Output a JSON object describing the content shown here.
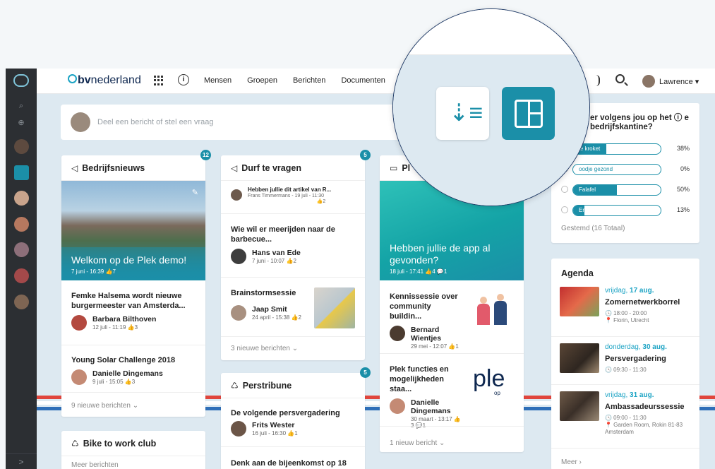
{
  "rail": {
    "collapse_glyph": ">"
  },
  "topbar": {
    "brand_bold": "bv",
    "brand_rest": "nederland",
    "nav": [
      "Mensen",
      "Groepen",
      "Berichten",
      "Documenten",
      "Ag"
    ],
    "user_name": "Lawrence ▾"
  },
  "post_box": {
    "placeholder": "Deel een bericht of stel een vraag"
  },
  "colors": {
    "accent": "#1b8fa8",
    "brand_navy": "#0f2850",
    "rail": "#2c2f33"
  },
  "col1": {
    "news": {
      "title": "Bedrijfsnieuws",
      "badge": "12",
      "hero_title": "Welkom op de Plek demo!",
      "hero_meta": "7 juni - 16:39  👍7",
      "items": [
        {
          "title": "Femke Halsema wordt nieuwe burgermeester van Amsterda...",
          "author": "Barbara Bilthoven",
          "meta": "12 juli - 11:19  👍3"
        },
        {
          "title": "Young Solar Challenge 2018",
          "author": "Danielle Dingemans",
          "meta": "9 juli - 15:05  👍3"
        }
      ],
      "more": "9 nieuwe berichten ⌄"
    },
    "bike": {
      "title": "Bike to work club",
      "more": "Meer berichten"
    }
  },
  "col2": {
    "ask": {
      "title": "Durf te vragen",
      "badge": "5",
      "items": [
        {
          "title": "Hebben jullie dit artikel van R...",
          "meta": "Frans Timmermans - 19 juli - 11:30",
          "likes": "👍2"
        },
        {
          "title": "Wie wil er meerijden naar de barbecue...",
          "author": "Hans van Ede",
          "meta": "7 juni - 10:07  👍2"
        },
        {
          "title": "Brainstormsessie",
          "author": "Jaap Smit",
          "meta": "24 april - 15:38  👍2"
        }
      ],
      "more": "3 nieuwe berichten ⌄"
    },
    "press": {
      "title": "Perstribune",
      "badge": "5",
      "items": [
        {
          "title": "De volgende persvergadering",
          "author": "Frits Wester",
          "meta": "16 juli - 16:30  👍1"
        },
        {
          "title": "Denk aan de bijeenkomst op 18"
        }
      ]
    }
  },
  "col3": {
    "title": "Pl",
    "hero_title": "Hebben jullie de app al gevonden?",
    "hero_meta": "18 juli - 17:41  👍4  💬1",
    "items": [
      {
        "title": "Kennissessie over community buildin...",
        "author": "Bernard Wientjes",
        "meta": "29 mei - 12:07  👍1"
      },
      {
        "title": "Plek functies en mogelijkheden staa...",
        "author": "Danielle Dingemans",
        "meta": "30 maart - 13:17  👍 3  💬1",
        "logo_text": "ple",
        "logo_sub": "op"
      }
    ],
    "more": "1 nieuw bericht ⌄"
  },
  "poll": {
    "question": "er volgens jou op het ⓘ e bedrijfskantine?",
    "options": [
      {
        "label": "je kroket",
        "pct": "38%",
        "fraction": 0.38
      },
      {
        "label": "oodje gezond",
        "pct": "0%",
        "fraction": 0.0
      },
      {
        "label": "Falafel",
        "pct": "50%",
        "fraction": 0.5
      },
      {
        "label": "Er mist helemaal niets!",
        "pct": "13%",
        "fraction": 0.13
      }
    ],
    "votes": "Gestemd (16 Totaal)"
  },
  "agenda": {
    "title": "Agenda",
    "items": [
      {
        "day": "vrijdag, ",
        "date": "17 aug.",
        "title": "Zomernetwerkborrel",
        "time": "🕓 18:00 - 20:00",
        "place": "📍 Florin, Utrecht",
        "place2": ""
      },
      {
        "day": "donderdag, ",
        "date": "30 aug.",
        "title": "Persvergadering",
        "time": "🕓 09:30 - 11:30",
        "place": "",
        "place2": ""
      },
      {
        "day": "vrijdag, ",
        "date": "31 aug.",
        "title": "Ambassadeurssessie",
        "time": "🕓 09:00 - 11:30",
        "place": "📍 Garden Room, Rokin 81-83",
        "place2": "Amsterdam"
      }
    ],
    "more": "Meer ›"
  }
}
